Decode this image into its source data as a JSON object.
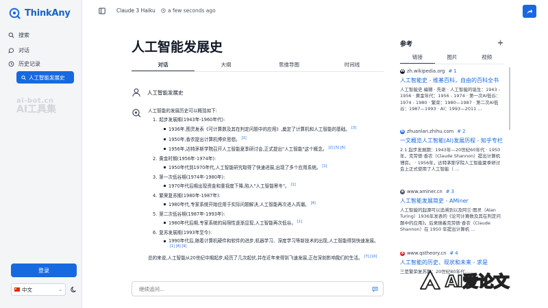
{
  "brand": {
    "name": "ThinkAny"
  },
  "sidebar": {
    "nav": [
      {
        "label": "搜索",
        "icon": "search-icon"
      },
      {
        "label": "对话",
        "icon": "chat-icon"
      },
      {
        "label": "历史记录",
        "icon": "history-icon"
      }
    ],
    "history_items": [
      {
        "label": "人工智能发展史"
      }
    ],
    "watermark_line1": "ai-bot.cn",
    "watermark_line2": "AI工具集",
    "login_label": "登录",
    "language": "中文"
  },
  "topbar": {
    "model": "Claude 3 Haiku",
    "timestamp": "a few seconds ago"
  },
  "main": {
    "title": "人工智能发展史",
    "tabs": [
      "对话",
      "大纲",
      "思维导图",
      "时间线"
    ],
    "question": "人工智能发展史",
    "answer": {
      "intro": "人工智能的发展历史可以概括如下:",
      "eras": [
        {
          "num": "1.",
          "heading": "起步发展期(1943年-1960年代):",
          "points": [
            {
              "text": "1936年,图灵发表《可计算数及其在判定问题中的应用》,奠定了计算机和人工智能的基础。",
              "cites": "[3]"
            },
            {
              "text": "1950年,香农提出计算机博弈思想。",
              "cites": "[2]"
            },
            {
              "text": "1956年,达特茅斯学院召开人工智能夏季研讨会,正式提出\"人工智能\"这个概念。",
              "cites": "[2] [5] [6]"
            }
          ]
        },
        {
          "num": "2.",
          "heading": "黄金时期(1956年-1974年):",
          "points": [
            {
              "text": "1950年代到1970年代,人工智能研究取得了快速进展,出现了多个应用系统。",
              "cites": "[1]"
            }
          ]
        },
        {
          "num": "3.",
          "heading": "第一次低谷期(1974年-1980年):",
          "points": [
            {
              "text": "1970年代后期出现资金和重视度下降,陷入\"人工智能寒冬\"。",
              "cites": "[1]"
            }
          ]
        },
        {
          "num": "4.",
          "heading": "繁荣复苏期(1980年-1987年):",
          "points": [
            {
              "text": "1980年代,专家系统开始应用于实际问题解决,人工智能再次进入高潮。",
              "cites": "[4]"
            }
          ]
        },
        {
          "num": "5.",
          "heading": "第二次低谷期(1987年-1993年):",
          "points": [
            {
              "text": "1980年代后期,专家系统的局限性逐渐显现,人工智能再次低谷。",
              "cites": "[1]"
            }
          ]
        },
        {
          "num": "6.",
          "heading": "复苏发展期(1993年至今):",
          "points": [
            {
              "text": "1990年代后,随着计算机硬件和软件的进步,机器学习、深度学习等新技术的出现,人工智能得到快速发展。",
              "cites": "[1] [8] [9]"
            }
          ]
        }
      ],
      "conclusion": "总的来说,人工智能从20世纪中期起步,经历了几次起伏,并在近年来得到飞速发展,正在深刻影响我们的生活。",
      "conclusion_cites": "[7] [10]"
    },
    "ask_placeholder": "继续追问..."
  },
  "refs": {
    "title": "参考",
    "tabs": [
      "链接",
      "图片",
      "视频"
    ],
    "items": [
      {
        "domain": "zh.wikipedia.org",
        "num": "# 1",
        "title": "人工智能史 - 维基百科，自由的百科全书",
        "snippet": "人工智能史 编辑 · 先驱 · 人工智能的诞生：1943 - 1956 · 黄金年代：1956 - 1974 · 第一次AI低谷：1974 - 1980 · 繁荣：1980—1987 · 第二次AI低谷：1987—1993 · AI：1993—2011 ...",
        "fav_color": "#111827",
        "fav_char": "W"
      },
      {
        "domain": "zhuanlan.zhihu.com",
        "num": "# 2",
        "title": "一文概览人工智能(AI)发展历程 - 知乎专栏",
        "snippet": "2.1 起步发展期：1943年—20世纪60年代 · 1950年，克劳德·香农（Claude Shannon）提出计算机博弈。 · 1956年，达特茅斯学院人工智能夏季研讨会上正式使用了人工智能（ ...",
        "fav_color": "#1769e0",
        "fav_char": "知"
      },
      {
        "domain": "www.aminer.cn",
        "num": "# 3",
        "title": "人工智能发展简史 - AMiner",
        "snippet": "人工智能的起源可以追溯到以及阿兰·图灵（Alan Turing）1936年发表的《论可计算数及其在判定问题中的应用》。后来随着克劳德·香农（Claude Shannon）在 1950 年提出计算机 ...",
        "fav_color": "#4b5563",
        "fav_char": "a"
      },
      {
        "domain": "www.qstheory.cn",
        "num": "# 4",
        "title": "人工智能的历史、现状和未来 - 求是",
        "snippet": "三是繁荣复苏期：20世纪80年代……",
        "fav_color": "#c81e1e",
        "fav_char": "求"
      }
    ]
  },
  "watermark": {
    "text": "AI爱论文"
  },
  "colors": {
    "accent": "#1769e0",
    "sidebar_bg": "#f4f5f7",
    "text": "#1f2937"
  }
}
